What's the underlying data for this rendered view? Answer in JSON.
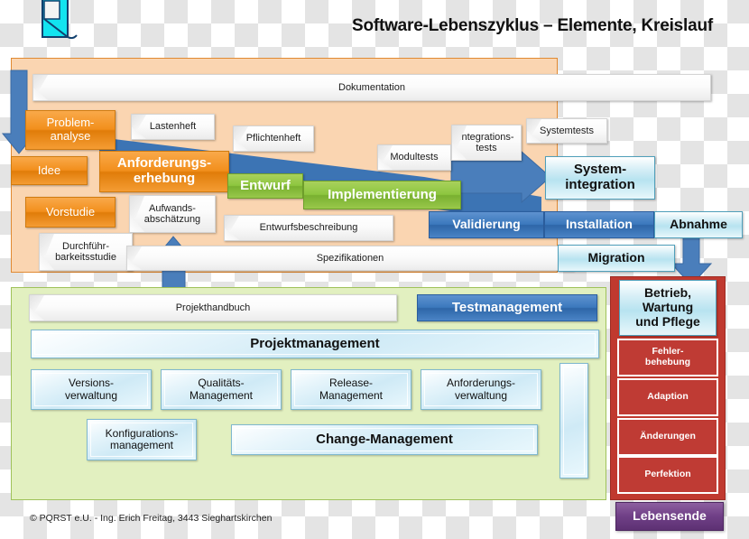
{
  "header": {
    "title": "Software-Lebenszyklus – Elemente, Kreislauf",
    "logo_name": "pqrst-logo"
  },
  "colors": {
    "orange_panel": "#fad5b1",
    "green_panel": "#e2f0c0",
    "red_panel": "#c0392f",
    "orange_box": "#f28f1c",
    "green_box": "#8dc63f",
    "blue_box": "#3b78bd",
    "cyan_box": "#b7e3f0",
    "purple_box": "#6f3f86",
    "arrow_blue": "#4a7ebb"
  },
  "lifecycle": {
    "documents": {
      "dokumentation": "Dokumentation",
      "lastenheft": "Lastenheft",
      "pflichtenheft": "Pflichtenheft",
      "modultests": "Modultests",
      "integrationstests": "Integrations-\ntests",
      "systemtests": "Systemtests",
      "aufwandsabschaetzung": "Aufwands-\nabschätzung",
      "durchfuehrbarkeitsstudie": "Durchführ-\nbarkeitsstudie",
      "entwurfsbeschreibung": "Entwurfsbeschreibung",
      "spezifikationen": "Spezifikationen"
    },
    "phases": {
      "problemanalyse": "Problem-\nanalyse",
      "idee": "Idee",
      "vorstudie": "Vorstudie",
      "anforderungserhebung": "Anforderungs-\nerhebung",
      "entwurf": "Entwurf",
      "implementierung": "Implementierung",
      "systemintegration": "System-\nintegration",
      "validierung": "Validierung",
      "installation": "Installation",
      "abnahme": "Abnahme",
      "migration": "Migration"
    }
  },
  "management": {
    "projekthandbuch": "Projekthandbuch",
    "testmanagement": "Testmanagement",
    "projektmanagement": "Projektmanagement",
    "versionsverwaltung": "Versions-\nverwaltung",
    "qualitaetsmanagement": "Qualitäts-\nManagement",
    "releasemanagement": "Release-\nManagement",
    "anforderungsverwaltung": "Anforderungs-\nverwaltung",
    "konfigurationsmanagement": "Konfigurations-\nmanagement",
    "changemanagement": "Change-Management",
    "empty_column": ""
  },
  "operations": {
    "betrieb": "Betrieb,\nWartung\nund Pflege",
    "items": [
      "Fehler-\nbehebung",
      "Adaption",
      "Änderungen",
      "Perfektion"
    ],
    "lebensende": "Lebensende"
  },
  "footer": {
    "copyright": "© PQRST e.U. - Ing. Erich Freitag, 3443 Sieghartskirchen"
  }
}
